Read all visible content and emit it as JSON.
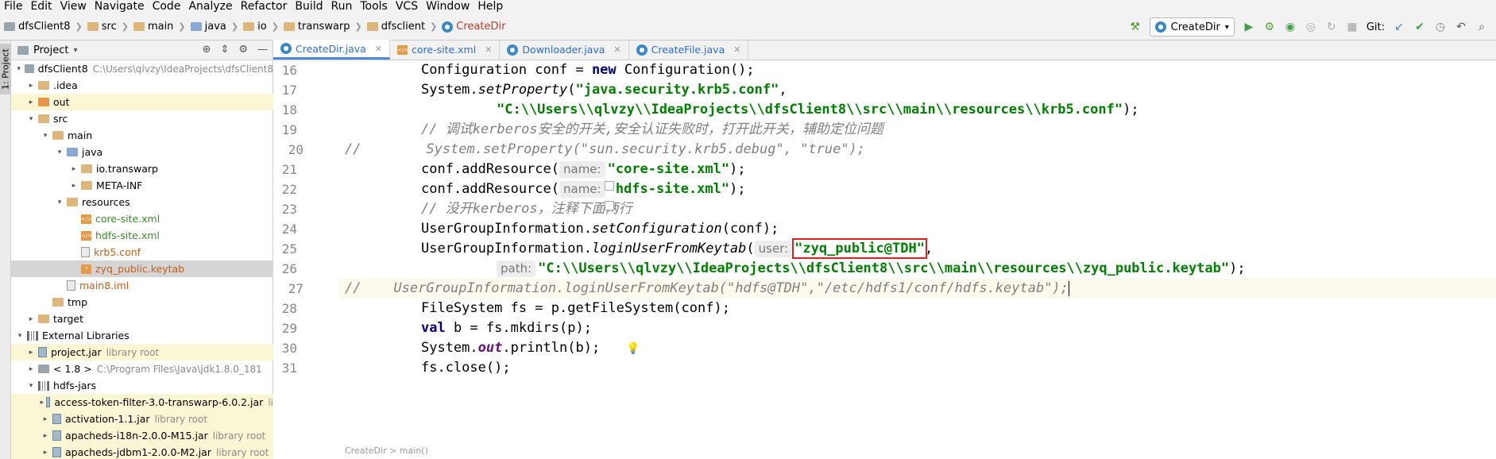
{
  "menu": [
    "File",
    "Edit",
    "View",
    "Navigate",
    "Code",
    "Analyze",
    "Refactor",
    "Build",
    "Run",
    "Tools",
    "VCS",
    "Window",
    "Help"
  ],
  "breadcrumbs": [
    "dfsClient8",
    "src",
    "main",
    "java",
    "io",
    "transwarp",
    "dfsclient",
    "CreateDir"
  ],
  "run_config": "CreateDir",
  "git_label": "Git:",
  "stripe_label": "1: Project",
  "project": {
    "title": "Project",
    "tree": [
      {
        "label": "dfsClient8",
        "sub": "C:\\Users\\qlvzy\\IdeaProjects\\dfsClient8"
      },
      {
        "label": ".idea"
      },
      {
        "label": "out"
      },
      {
        "label": "src"
      },
      {
        "label": "main"
      },
      {
        "label": "java"
      },
      {
        "label": "io.transwarp"
      },
      {
        "label": "META-INF"
      },
      {
        "label": "resources"
      },
      {
        "label": "core-site.xml"
      },
      {
        "label": "hdfs-site.xml"
      },
      {
        "label": "krb5.conf"
      },
      {
        "label": "zyq_public.keytab"
      },
      {
        "label": "main8.iml"
      },
      {
        "label": "tmp"
      },
      {
        "label": "target"
      },
      {
        "label": "External Libraries"
      },
      {
        "label": "project.jar",
        "sub": "library root"
      },
      {
        "label": "< 1.8 >",
        "sub": "C:\\Program Files\\Java\\jdk1.8.0_181"
      },
      {
        "label": "hdfs-jars"
      },
      {
        "label": "access-token-filter-3.0-transwarp-6.0.2.jar",
        "sub": "li"
      },
      {
        "label": "activation-1.1.jar",
        "sub": "library root"
      },
      {
        "label": "apacheds-i18n-2.0.0-M15.jar",
        "sub": "library root"
      },
      {
        "label": "apacheds-jdbm1-2.0.0-M2.jar",
        "sub": "library root"
      }
    ]
  },
  "tabs": [
    "CreateDir.java",
    "core-site.xml",
    "Downloader.java",
    "CreateFile.java"
  ],
  "line_numbers": [
    "16",
    "17",
    "18",
    "19",
    "20",
    "21",
    "22",
    "23",
    "24",
    "25",
    "26",
    "27",
    "28",
    "29",
    "30",
    "31"
  ],
  "code": {
    "l16a": "Configuration conf = ",
    "l16k": "new",
    "l16b": " Configuration();",
    "l17a": "System.",
    "l17m": "setProperty",
    "l17b": "(",
    "l17s": "\"java.security.krb5.conf\"",
    "l17c": ",",
    "l18s": "\"C:\\\\Users\\\\qlvzy\\\\IdeaProjects\\\\dfsClient8\\\\src\\\\main\\\\resources\\\\krb5.conf\"",
    "l18b": ");",
    "l19": "// 调试kerberos安全的开关,安全认证失败时，打开此开关，辅助定位问题",
    "l20": "//        System.setProperty(\"sun.security.krb5.debug\", \"true\");",
    "l21a": "conf.addResource(",
    "l21h": "name:",
    "l21s": "\"core-site.xml\"",
    "l21b": ");",
    "l22a": "conf.addResource(",
    "l22h": "name:",
    "l22s": "\"hdfs-site.xml\"",
    "l22b": ");",
    "l23": "// 没开kerberos，注释下面两行",
    "l24a": "UserGroupInformation.",
    "l24m": "setConfiguration",
    "l24b": "(conf);",
    "l25a": "UserGroupInformation.",
    "l25m": "loginUserFromKeytab",
    "l25b": "(",
    "l25h": "user:",
    "l25s": "\"zyq_public@TDH\"",
    "l25c": ",",
    "l26h": "path:",
    "l26s": "\"C:\\\\Users\\\\qlvzy\\\\IdeaProjects\\\\dfsClient8\\\\src\\\\main\\\\resources\\\\zyq_public.keytab\"",
    "l26b": ");",
    "l27": "//    UserGroupInformation.loginUserFromKeytab(\"hdfs@TDH\",\"/etc/hdfs1/conf/hdfs.keytab\");",
    "l28": "FileSystem fs = p.getFileSystem(conf);",
    "l29k": "val",
    "l29b": " b = fs.mkdirs(p);",
    "l30a": "System.",
    "l30o": "out",
    "l30b": ".println(b);",
    "l31": "fs.close();"
  },
  "status_breadcrumb": "CreateDir  >  main()"
}
